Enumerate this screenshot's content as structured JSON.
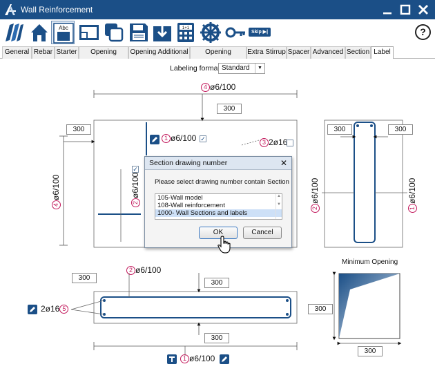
{
  "window": {
    "title": "Wall Reinforcement",
    "controls": [
      "minimize",
      "maximize",
      "close"
    ]
  },
  "toolbar": {
    "buttons": [
      {
        "name": "wall-model-icon"
      },
      {
        "name": "home-icon"
      },
      {
        "name": "label-abc-icon",
        "label": "Abc",
        "active": true
      },
      {
        "name": "window-layout-icon"
      },
      {
        "name": "copy-icon"
      },
      {
        "name": "save-icon"
      },
      {
        "name": "import-icon"
      },
      {
        "name": "calculator-icon",
        "label": "1+1"
      },
      {
        "name": "settings-wheel-icon"
      },
      {
        "name": "key-icon"
      }
    ],
    "skip_label": "Skip ▶|",
    "help_label": "?"
  },
  "tabs": [
    {
      "label": "General"
    },
    {
      "label": "Rebar"
    },
    {
      "label": "Starter"
    },
    {
      "label": "Opening Stirrup"
    },
    {
      "label": "Opening Additional"
    },
    {
      "label": "Opening Diagonal"
    },
    {
      "label": "Extra Stirrup"
    },
    {
      "label": "Spacer"
    },
    {
      "label": "Advanced"
    },
    {
      "label": "Section"
    },
    {
      "label": "Label",
      "active": true
    }
  ],
  "labeling": {
    "label": "Labeling format:",
    "value": "Standard"
  },
  "elevation": {
    "top_label": {
      "num": "4",
      "text": "ø6/100"
    },
    "top_offset": "300",
    "left_offset": "300",
    "left_vertical_label": {
      "num": "4",
      "text": "ø6/100"
    },
    "mid_label": {
      "num": "1",
      "text": "ø6/100",
      "checked": true
    },
    "diag_label": {
      "num": "3",
      "text": "2ø16",
      "checked": false
    },
    "inner_vertical_label": {
      "num": "2",
      "text": "ø6/100"
    },
    "inner_check": true
  },
  "side_section": {
    "left_offset": "300",
    "right_offset": "300",
    "left_label": {
      "num": "2",
      "text": "ø6/100"
    },
    "right_label": {
      "num": "1",
      "text": "ø6/100"
    }
  },
  "plan_section": {
    "top_label": {
      "num": "2",
      "text": "ø6/100"
    },
    "left_offset": "300",
    "top_offset": "300",
    "bottom_offset": "300",
    "bar_label": {
      "num": "5",
      "text": "2ø16"
    },
    "bottom_label": {
      "num": "1",
      "text": "ø6/100"
    }
  },
  "minimum_opening": {
    "title": "Minimum Opening",
    "height_value": "300",
    "width_value": "300"
  },
  "dialog": {
    "title": "Section drawing number",
    "close_label": "✕",
    "prompt": "Please select drawing number contain Section",
    "options": [
      {
        "label": "105-Wall model"
      },
      {
        "label": "108-Wall reinforcement"
      },
      {
        "label": "1000- Wall Sections and labels",
        "selected": true
      }
    ],
    "ok_label": "OK",
    "cancel_label": "Cancel"
  }
}
